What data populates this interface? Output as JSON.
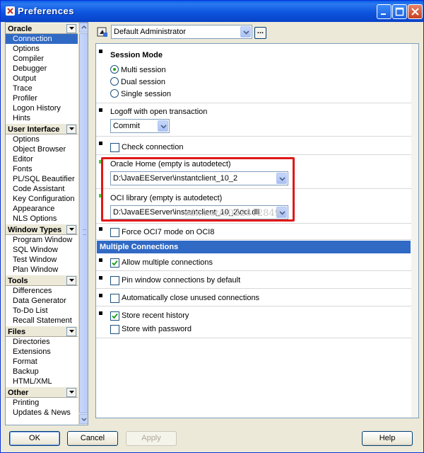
{
  "window": {
    "title": "Preferences"
  },
  "nav": {
    "groups": [
      {
        "title": "Oracle",
        "items": [
          "Connection",
          "Options",
          "Compiler",
          "Debugger",
          "Output",
          "Trace",
          "Profiler",
          "Logon History",
          "Hints"
        ]
      },
      {
        "title": "User Interface",
        "items": [
          "Options",
          "Object Browser",
          "Editor",
          "Fonts",
          "PL/SQL Beautifier",
          "Code Assistant",
          "Key Configuration",
          "Appearance",
          "NLS Options"
        ]
      },
      {
        "title": "Window Types",
        "items": [
          "Program Window",
          "SQL Window",
          "Test Window",
          "Plan Window"
        ]
      },
      {
        "title": "Tools",
        "items": [
          "Differences",
          "Data Generator",
          "To-Do List",
          "Recall Statement"
        ]
      },
      {
        "title": "Files",
        "items": [
          "Directories",
          "Extensions",
          "Format",
          "Backup",
          "HTML/XML"
        ]
      },
      {
        "title": "Other",
        "items": [
          "Printing",
          "Updates & News"
        ]
      }
    ],
    "selected": "Connection"
  },
  "profile": {
    "value": "Default Administrator",
    "ellipsis_label": "..."
  },
  "settings": {
    "session_mode": {
      "label": "Session Mode",
      "options": [
        "Multi session",
        "Dual session",
        "Single session"
      ],
      "selected": "Multi session"
    },
    "logoff": {
      "label": "Logoff with open transaction",
      "value": "Commit"
    },
    "check_connection": {
      "label": "Check connection",
      "checked": false
    },
    "oracle_home": {
      "label": "Oracle Home (empty is autodetect)",
      "value": "D:\\JavaEEServer\\instantclient_10_2"
    },
    "oci_library": {
      "label": "OCI library (empty is autodetect)",
      "value": "D:\\JavaEEServer\\instantclient_10_2\\oci.dll"
    },
    "force_oci7": {
      "label": "Force OCI7 mode on OCI8",
      "checked": false
    },
    "multiple_connections": {
      "header": "Multiple Connections",
      "allow_multiple": {
        "label": "Allow multiple connections",
        "checked": true
      },
      "pin_window": {
        "label": "Pin window connections by default",
        "checked": false
      },
      "auto_close": {
        "label": "Automatically close unused connections",
        "checked": false
      },
      "store_history": {
        "label": "Store recent history",
        "checked": true
      },
      "store_password": {
        "label": "Store with password",
        "checked": false
      }
    }
  },
  "watermark": "sdn.net/u022812849",
  "buttons": {
    "ok": "OK",
    "cancel": "Cancel",
    "apply": "Apply",
    "help": "Help"
  },
  "colors": {
    "titlebar": "#0a5fe8",
    "selection": "#316ac5",
    "highlight_box": "#e01818",
    "modified_marker": "#3ad23a"
  }
}
